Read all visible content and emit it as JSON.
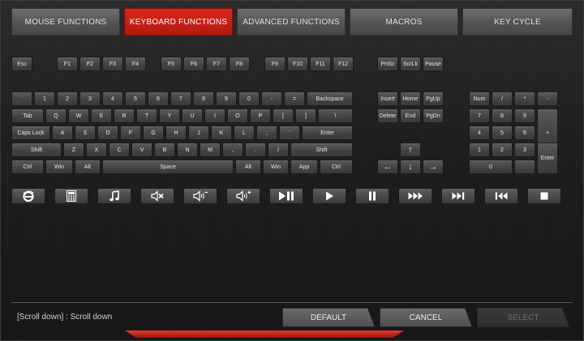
{
  "tabs": [
    {
      "label": "MOUSE FUNCTIONS"
    },
    {
      "label": "KEYBOARD FUNCTIONS"
    },
    {
      "label": "ADVANCED FUNCTIONS"
    },
    {
      "label": "MACROS"
    },
    {
      "label": "KEY CYCLE"
    }
  ],
  "fkeys": [
    "Esc",
    "F1",
    "F2",
    "F3",
    "F4",
    "F5",
    "F6",
    "F7",
    "F8",
    "F9",
    "F10",
    "F11",
    "F12",
    "PrtSc",
    "ScrLk",
    "Pause"
  ],
  "row_number": [
    "`",
    "1",
    "2",
    "3",
    "4",
    "5",
    "6",
    "7",
    "8",
    "9",
    "0",
    "-",
    "=",
    "Backspace"
  ],
  "row_tab": [
    "Tab",
    "Q",
    "W",
    "E",
    "R",
    "T",
    "Y",
    "U",
    "I",
    "O",
    "P",
    "[",
    "]",
    "\\"
  ],
  "row_caps": [
    "Caps Lock",
    "A",
    "S",
    "D",
    "F",
    "G",
    "H",
    "J",
    "K",
    "L",
    ";",
    "'",
    "Enter"
  ],
  "row_shift": [
    "Shift",
    "Z",
    "X",
    "C",
    "V",
    "B",
    "N",
    "M",
    ",",
    ".",
    "/",
    "Shift"
  ],
  "row_ctrl": [
    "Ctrl",
    "Win",
    "Alt",
    "Space",
    "Alt",
    "Win",
    "App",
    "Ctrl"
  ],
  "nav": [
    "Insert",
    "Home",
    "PgUp",
    "Delete",
    "End",
    "PgDn"
  ],
  "arrows": [
    "↑",
    "←",
    "↓",
    "→"
  ],
  "numpad": [
    "Num",
    "/",
    "*",
    "-",
    "7",
    "8",
    "9",
    "+",
    "4",
    "5",
    "6",
    "1",
    "2",
    "3",
    "Enter",
    "0",
    "."
  ],
  "media_icons": [
    "ie-icon",
    "calculator-icon",
    "music-note-icon",
    "mute-icon",
    "volume-down-icon",
    "volume-up-icon",
    "play-pause-icon",
    "play-icon",
    "pause-icon",
    "fast-forward-icon",
    "next-track-icon",
    "previous-track-icon",
    "stop-icon"
  ],
  "status_text": "[Scroll down] : Scroll down",
  "buttons": {
    "default": "DEFAULT",
    "cancel": "CANCEL",
    "select": "SELECT"
  },
  "colors": {
    "accent": "#c21f14",
    "key_bg": "#4a4a4a",
    "background": "#1d1d1d"
  }
}
